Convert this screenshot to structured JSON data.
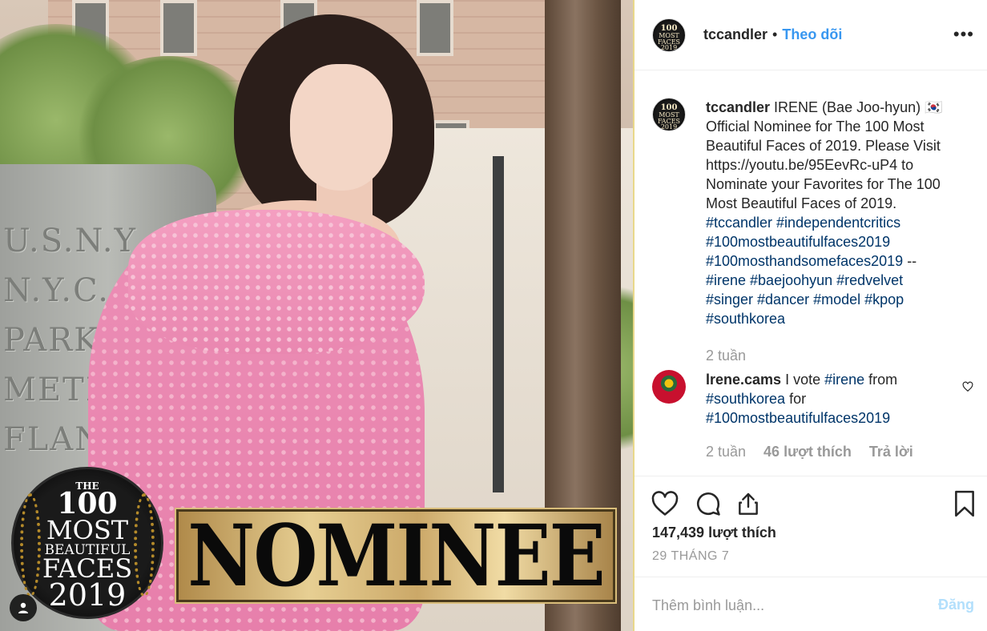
{
  "post_image": {
    "badge": {
      "the": "THE",
      "hundred": "100",
      "most": "MOST",
      "beautiful": "BEAUTIFUL",
      "faces": "FACES",
      "year": "2019"
    },
    "nominee_text": "NOMINEE",
    "pillar_text": "U.S.N.Y.\nN.Y.C.\nPARKING\nMETER\nFLANG",
    "user_tag_icon": "person-icon"
  },
  "header": {
    "username": "tccandler",
    "dot": "•",
    "follow_label": "Theo dõi",
    "more_icon": "•••",
    "avatar_text": {
      "line1": "100",
      "line2": "MOST",
      "line3": "FACES",
      "line4": "2019"
    }
  },
  "caption": {
    "username": "tccandler",
    "text_before": " IRENE (Bae Joo-hyun) 🇰🇷 Official Nominee for The 100 Most Beautiful Faces of 2019. Please Visit https://youtu.be/95EevRc-uP4 to Nominate your Favorites for The 100 Most Beautiful Faces of 2019. ",
    "tags_line1": "#tccandler #independentcritics",
    "tags_line2": "#100mostbeautifulfaces2019",
    "tags_line3": "#100mosthandsomefaces2019",
    "dashes": " --",
    "tags_line4": "#irene #baejoohyun #redvelvet",
    "tags_line5": "#singer #dancer #model #kpop",
    "tags_line6": "#southkorea",
    "timestamp": "2 tuần"
  },
  "comment": {
    "username": "lrene.cams",
    "text1": " I vote ",
    "tag1": "#irene",
    "text2": " from ",
    "tag2": "#southkorea",
    "text3": " for ",
    "tag3": "#100mostbeautifulfaces2019",
    "timestamp": "2 tuần",
    "likes": "46 lượt thích",
    "reply_label": "Trả lời"
  },
  "actions": {
    "likes": "147,439 lượt thích",
    "date": "29 THÁNG 7"
  },
  "add_comment": {
    "placeholder": "Thêm bình luận...",
    "post_label": "Đăng"
  },
  "colors": {
    "link": "#3897f0",
    "hashtag": "#003569",
    "muted": "#999999",
    "post_disabled": "#b2dffc"
  }
}
